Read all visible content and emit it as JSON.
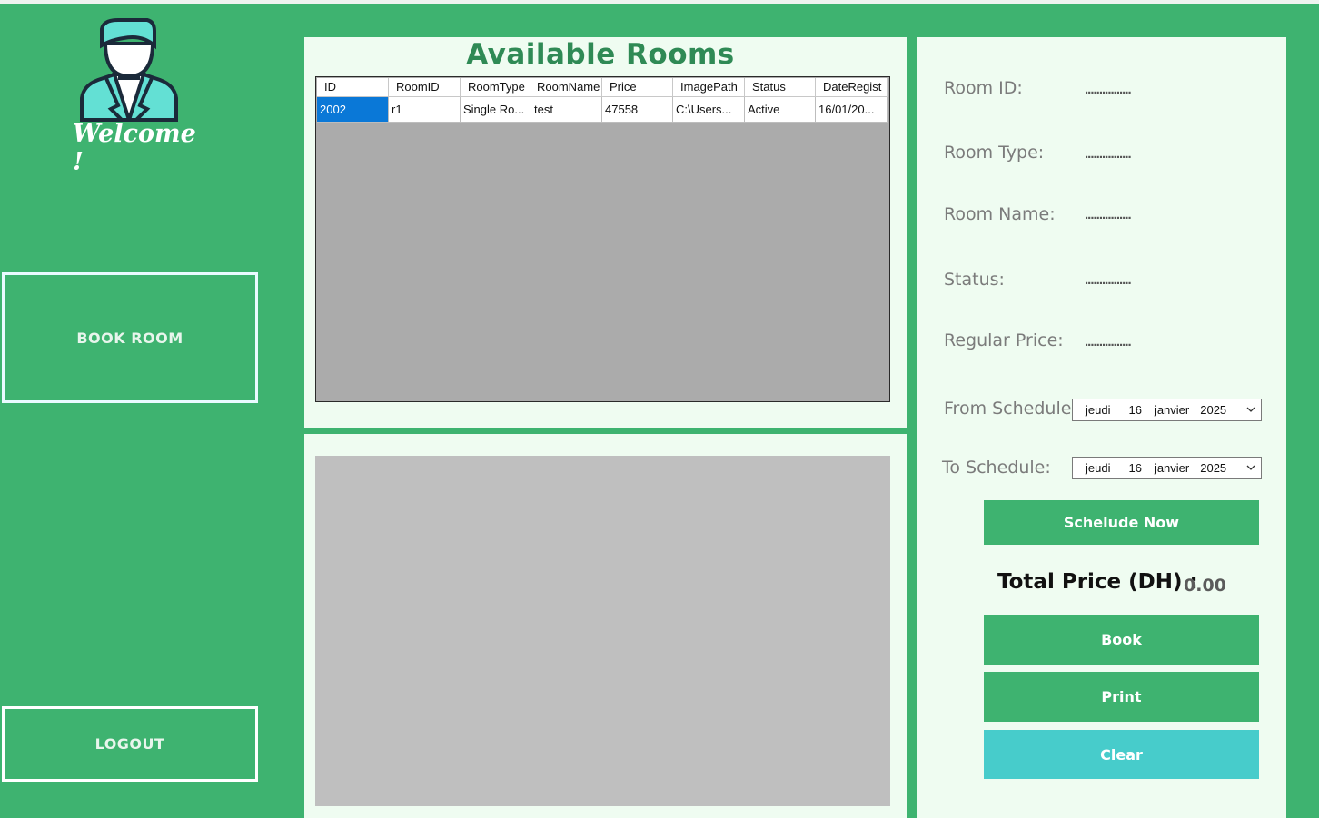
{
  "sidebar": {
    "welcome": "Welcome !",
    "book_room": "BOOK ROOM",
    "logout": "LOGOUT"
  },
  "rooms": {
    "title": "Available Rooms",
    "columns": [
      "ID",
      "RoomID",
      "RoomType",
      "RoomName",
      "Price",
      "ImagePath",
      "Status",
      "DateRegist"
    ],
    "rows": [
      [
        "2002",
        "r1",
        "Single Ro...",
        "test",
        "47558",
        "C:\\Users...",
        "Active",
        "16/01/20..."
      ]
    ]
  },
  "details": {
    "room_id_label": "Room ID:",
    "room_id_value": "................",
    "room_type_label": "Room Type:",
    "room_type_value": "................",
    "room_name_label": "Room Name:",
    "room_name_value": "................",
    "status_label": "Status:",
    "status_value": "................",
    "regular_price_label": "Regular Price:",
    "regular_price_value": "................",
    "from_label": "From Schedule:",
    "from_date": {
      "day": "jeudi",
      "num": "16",
      "month": "janvier",
      "year": "2025"
    },
    "to_label": "To  Schedule:",
    "to_date": {
      "day": "jeudi",
      "num": "16",
      "month": "janvier",
      "year": "2025"
    },
    "schedule_now": "Schelude Now",
    "total_label": "Total Price (DH) :",
    "total_value": "0.00",
    "book": "Book",
    "print": "Print",
    "clear": "Clear"
  },
  "colors": {
    "background": "#3eb370",
    "panel": "#effcf1",
    "title": "#2f8a55",
    "selected_cell": "#0a78d7",
    "clear_button": "#47cccb"
  },
  "icons": [
    "avatar-icon",
    "chevron-down-icon"
  ]
}
